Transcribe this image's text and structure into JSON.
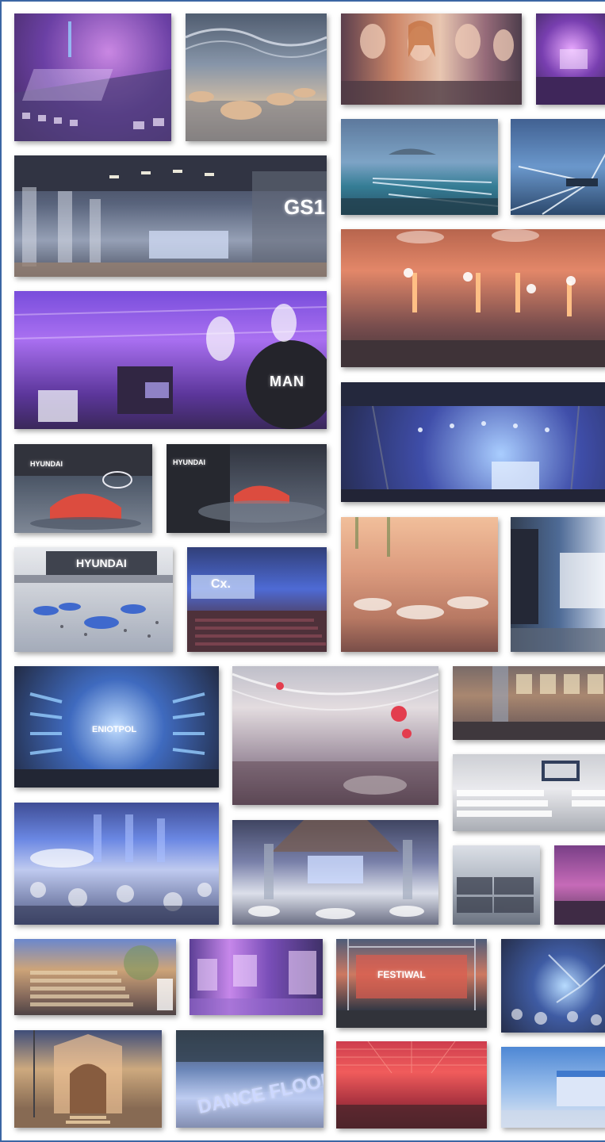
{
  "collage": {
    "photos": [
      {
        "name": "mixing-console",
        "text": ""
      },
      {
        "name": "decorated-tent-hall",
        "text": ""
      },
      {
        "name": "fashion-stage",
        "text": ""
      },
      {
        "name": "purple-concert",
        "text": ""
      },
      {
        "name": "lake-laser-show",
        "text": ""
      },
      {
        "name": "laser-beams",
        "text": ""
      },
      {
        "name": "gs1-conference-hall",
        "text": "GS1"
      },
      {
        "name": "stage-light-towers",
        "text": ""
      },
      {
        "name": "man-truck-event",
        "text": "MAN"
      },
      {
        "name": "concert-stage",
        "text": ""
      },
      {
        "name": "hyundai-stand-red-car",
        "text": "HYUNDAI"
      },
      {
        "name": "hyundai-stand-2",
        "text": "HYUNDAI"
      },
      {
        "name": "hyundai-expo-hall",
        "text": "HYUNDAI"
      },
      {
        "name": "cx-conference",
        "text": "Cx."
      },
      {
        "name": "banquet-tent",
        "text": ""
      },
      {
        "name": "led-screen-room",
        "text": ""
      },
      {
        "name": "eniotpol-stage",
        "text": "ENIOTPOL"
      },
      {
        "name": "festive-tent",
        "text": ""
      },
      {
        "name": "hall-windows-banquet",
        "text": ""
      },
      {
        "name": "white-chairs-screen",
        "text": ""
      },
      {
        "name": "blue-gala-hall",
        "text": ""
      },
      {
        "name": "timber-hall-gala",
        "text": ""
      },
      {
        "name": "flightcases",
        "text": ""
      },
      {
        "name": "pink-lit-hall",
        "text": ""
      },
      {
        "name": "stairs-entrance",
        "text": ""
      },
      {
        "name": "purple-led-walls",
        "text": ""
      },
      {
        "name": "outdoor-led-screen",
        "text": "FESTIWAL"
      },
      {
        "name": "blue-dance-hall",
        "text": ""
      },
      {
        "name": "illuminated-gate",
        "text": ""
      },
      {
        "name": "dance-floor-letters",
        "text": "DANCE FLOOR"
      },
      {
        "name": "red-ceiling-hall",
        "text": ""
      },
      {
        "name": "conference-screen-stage",
        "text": ""
      }
    ]
  }
}
